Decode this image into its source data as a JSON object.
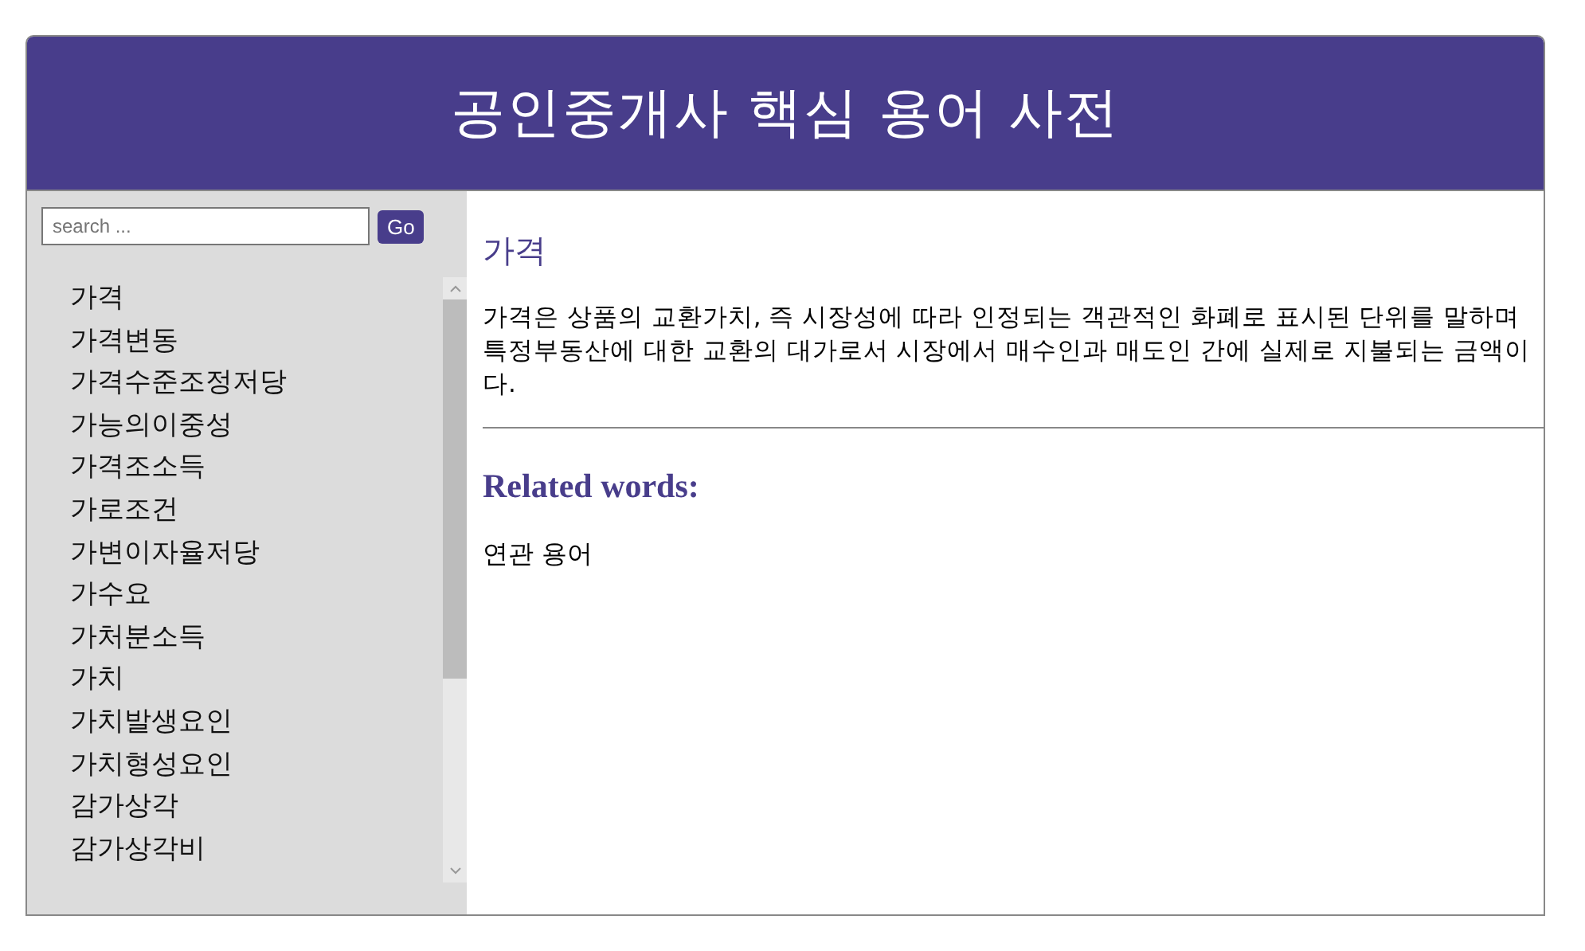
{
  "header": {
    "title": "공인중개사 핵심 용어 사전"
  },
  "search": {
    "placeholder": "search ...",
    "button": "Go"
  },
  "terms": [
    "가격",
    "가격변동",
    "가격수준조정저당",
    "가능의이중성",
    "가격조소득",
    "가로조건",
    "가변이자율저당",
    "가수요",
    "가처분소득",
    "가치",
    "가치발생요인",
    "가치형성요인",
    "감가상각",
    "감가상각비"
  ],
  "entry": {
    "term": "가격",
    "definition": "가격은 상품의 교환가치, 즉 시장성에 따라 인정되는 객관적인 화폐로 표시된 단위를 말하며 특정부동산에 대한 교환의 대가로서 시장에서 매수인과 매도인 간에 실제로 지불되는 금액이다.",
    "related_heading": "Related words:",
    "related": [
      "연관 용어"
    ]
  }
}
